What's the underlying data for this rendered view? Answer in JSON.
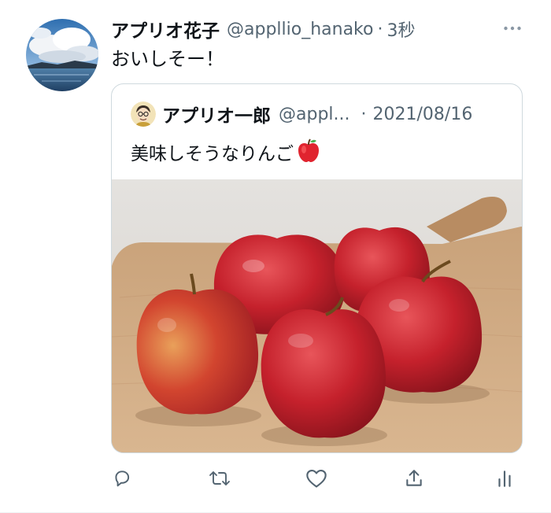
{
  "tweet": {
    "author_name": "アプリオ花子",
    "author_handle": "@appllio_hanako",
    "separator": "·",
    "time": "3秒",
    "text": "おいしそー！",
    "more_icon": "more-horizontal-icon"
  },
  "quote": {
    "author_name": "アプリオ一郎",
    "author_handle": "@appl...",
    "separator": "·",
    "date": "2021/08/16",
    "text": "美味しそうなりんご",
    "emoji": "red-apple-emoji",
    "image": "apples-on-cutting-board-photo"
  },
  "actions": [
    {
      "name": "reply",
      "icon": "reply-icon"
    },
    {
      "name": "retweet",
      "icon": "retweet-icon"
    },
    {
      "name": "like",
      "icon": "heart-icon"
    },
    {
      "name": "share",
      "icon": "share-icon"
    },
    {
      "name": "analytics",
      "icon": "analytics-icon"
    }
  ],
  "colors": {
    "text_primary": "#0f1419",
    "text_secondary": "#536471",
    "icon": "#536471",
    "border": "#cfd9de"
  }
}
